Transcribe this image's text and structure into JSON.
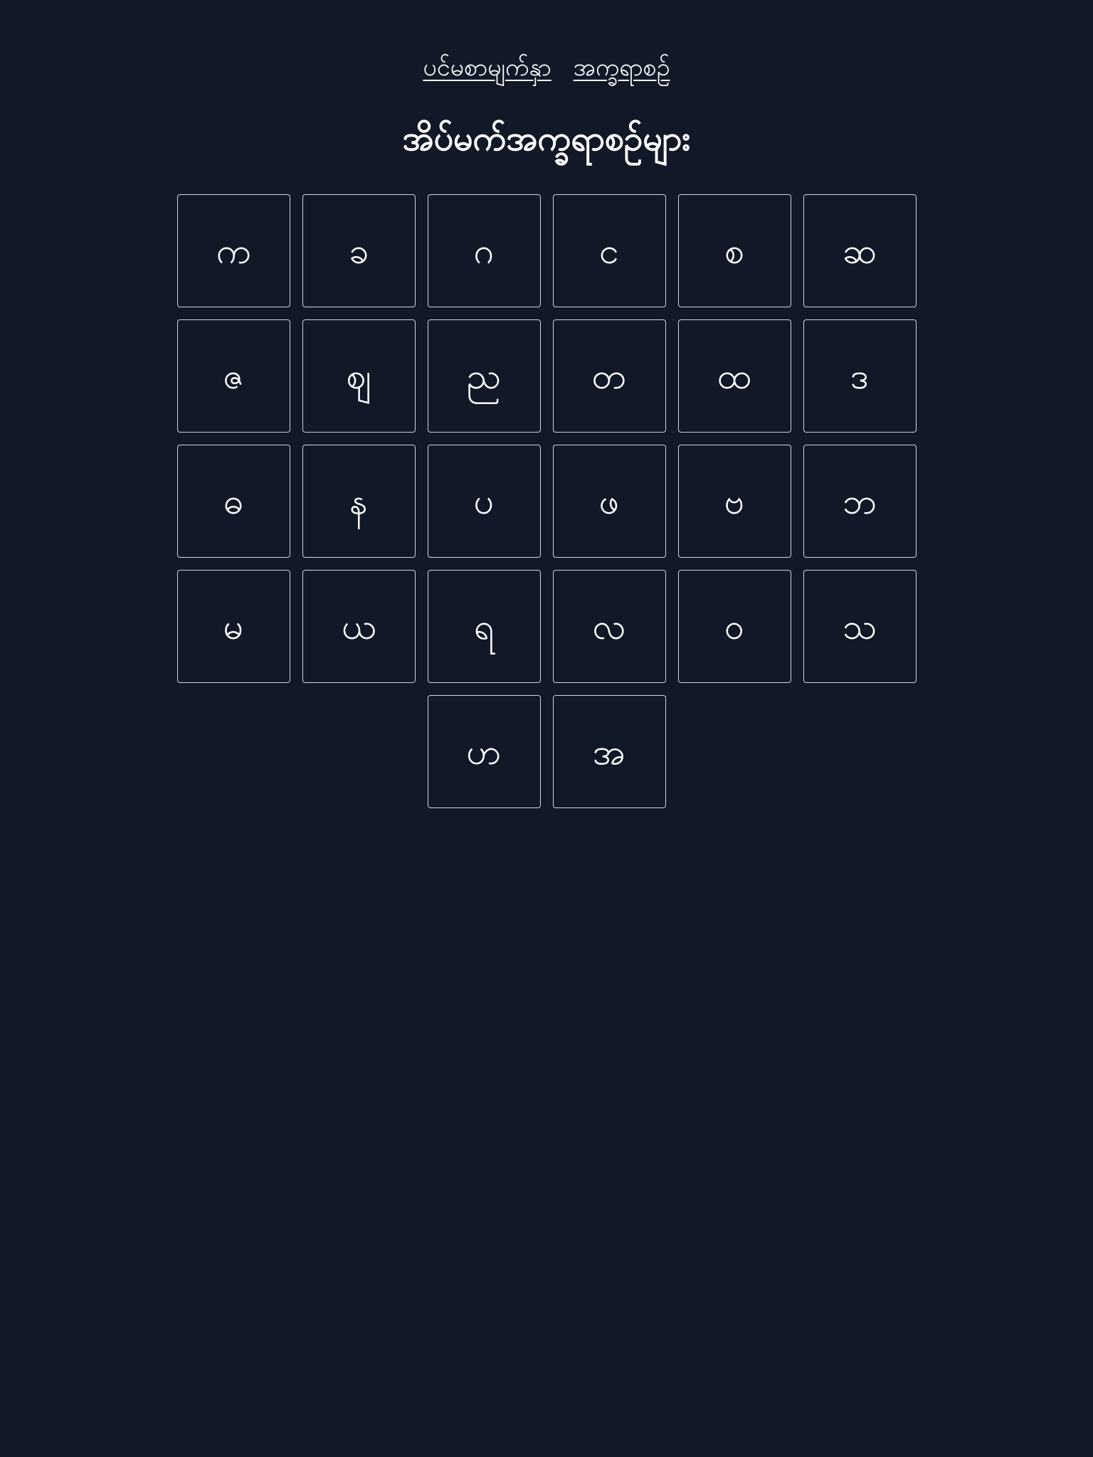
{
  "nav": {
    "links": [
      {
        "label": "ပင်မစာမျက်နှာ"
      },
      {
        "label": "အက္ခရာစဉ်"
      }
    ]
  },
  "page_title": "အိပ်မက်အက္ခရာစဉ်များ",
  "colors": {
    "background": "#111827",
    "text": "#ffffff",
    "tile_border": "#d1d5db"
  },
  "letters": [
    "က",
    "ခ",
    "ဂ",
    "င",
    "စ",
    "ဆ",
    "ဇ",
    "ဈ",
    "ည",
    "တ",
    "ထ",
    "ဒ",
    "ဓ",
    "န",
    "ပ",
    "ဖ",
    "ဗ",
    "ဘ",
    "မ",
    "ယ",
    "ရ",
    "လ",
    "ဝ",
    "သ",
    "ဟ",
    "အ"
  ]
}
